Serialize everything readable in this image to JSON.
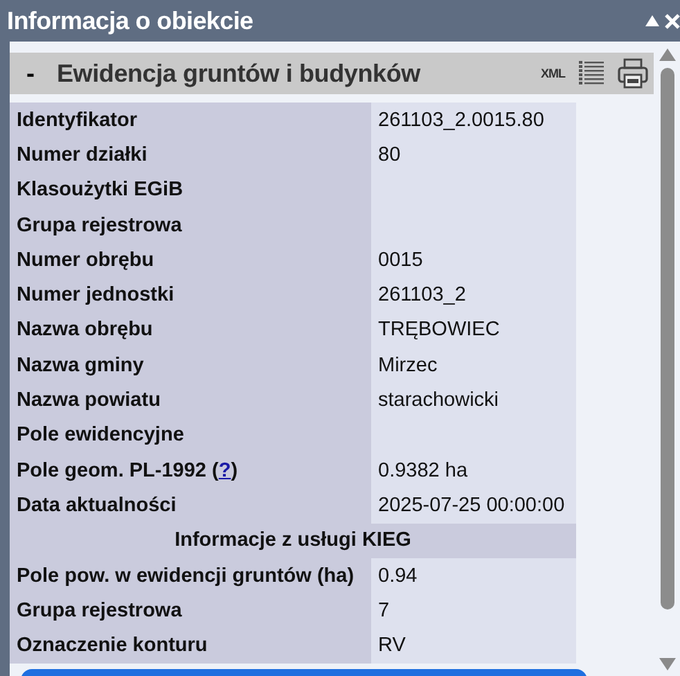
{
  "window": {
    "title": "Informacja o obiekcie"
  },
  "section": {
    "toggle": "-",
    "title": "Ewidencja gruntów i budynków",
    "xml": "XML"
  },
  "rows": [
    {
      "kind": "field",
      "label": "Identyfikator",
      "value": "261103_2.0015.80"
    },
    {
      "kind": "field",
      "label": "Numer działki",
      "value": "80"
    },
    {
      "kind": "field",
      "label": "Klasoużytki EGiB"
    },
    {
      "kind": "field",
      "label": "Grupa rejestrowa"
    },
    {
      "kind": "field",
      "label": "Numer obrębu",
      "value": "0015"
    },
    {
      "kind": "field",
      "label": "Numer jednostki",
      "value": "261103_2"
    },
    {
      "kind": "field",
      "label": "Nazwa obrębu",
      "value": "TRĘBOWIEC"
    },
    {
      "kind": "field",
      "label": "Nazwa gminy",
      "value": "Mirzec"
    },
    {
      "kind": "field",
      "label": "Nazwa powiatu",
      "value": "starachowicki"
    },
    {
      "kind": "field",
      "label": "Pole ewidencyjne"
    },
    {
      "kind": "field",
      "label": "Pole geom. PL-1992 (",
      "link": "?",
      "label_after": ")",
      "value": "0.9382 ha"
    },
    {
      "kind": "field",
      "label": "Data aktualności",
      "value": "2025-07-25 00:00:00"
    },
    {
      "kind": "heading",
      "label": "Informacje z usługi KIEG"
    },
    {
      "kind": "field",
      "label": "Pole pow. w ewidencji gruntów (ha)",
      "value": "0.94"
    },
    {
      "kind": "field",
      "label": "Grupa rejestrowa",
      "value": "7"
    },
    {
      "kind": "field",
      "label": "Oznaczenie konturu",
      "value": "RV"
    }
  ]
}
